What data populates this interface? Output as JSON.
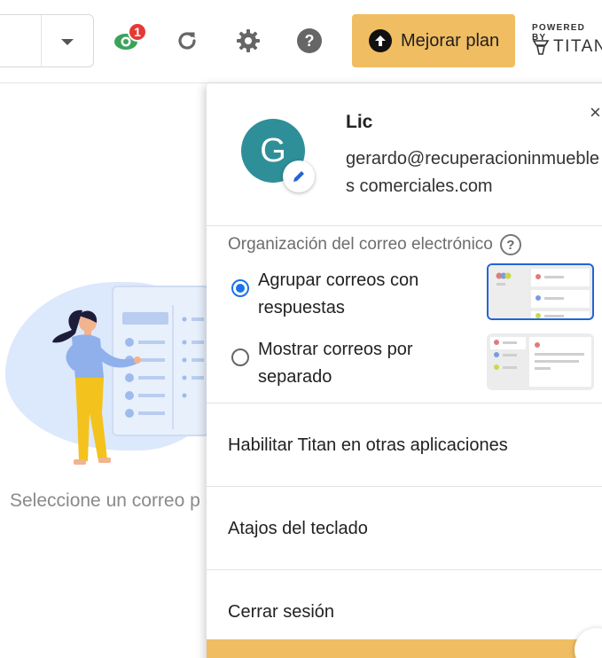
{
  "toolbar": {
    "notification_count": "1",
    "upgrade_label": "Mejorar plan",
    "powered_by": "POWERED BY",
    "brand": "TITAN"
  },
  "main": {
    "empty_message": "Seleccione un correo p"
  },
  "profile_menu": {
    "avatar_letter": "G",
    "name": "Lic",
    "email": "gerardo@recuperacioninmuebles comerciales.com",
    "close_symbol": "×",
    "organization": {
      "title": "Organización del correo electrónico",
      "help_symbol": "?",
      "options": [
        {
          "label": "Agrupar correos con respuestas",
          "selected": true
        },
        {
          "label": "Mostrar correos por separado",
          "selected": false
        }
      ]
    },
    "items": [
      {
        "label": "Habilitar Titan en otras aplicaciones"
      },
      {
        "label": "Atajos del teclado"
      },
      {
        "label": "Cerrar sesión"
      }
    ]
  },
  "colors": {
    "accent_upgrade": "#f0bd62",
    "avatar_bg": "#2f8f98",
    "radio_selected": "#1a73e8",
    "badge": "#e53935"
  },
  "icons": [
    "chevron-down-icon",
    "eye-icon",
    "refresh-icon",
    "gear-icon",
    "help-icon",
    "arrow-up-icon",
    "titan-logo-icon",
    "close-icon",
    "pencil-icon",
    "question-icon"
  ]
}
